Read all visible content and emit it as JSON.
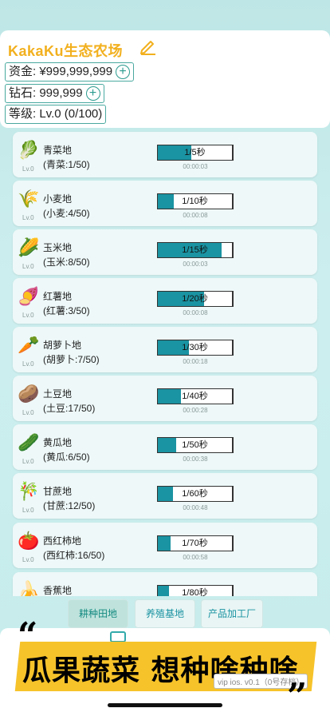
{
  "header": {
    "farm_title": "KakaKu生态农场",
    "funds": "资金: ¥999,999,999",
    "diamonds": "钻石: 999,999",
    "level": "等级: Lv.0 (0/100)",
    "plus_symbol": "+"
  },
  "crops": [
    {
      "name": "青菜地",
      "count": "(青菜:1/50)",
      "bar": "1/5秒",
      "timer": "00:00:03",
      "progress": 0.45,
      "lv": "Lv.0",
      "icon": "cabbage-icon",
      "glyph": "🥬"
    },
    {
      "name": "小麦地",
      "count": "(小麦:4/50)",
      "bar": "1/10秒",
      "timer": "00:00:08",
      "progress": 0.22,
      "lv": "Lv.0",
      "icon": "wheat-icon",
      "glyph": "🌾"
    },
    {
      "name": "玉米地",
      "count": "(玉米:8/50)",
      "bar": "1/15秒",
      "timer": "00:00:03",
      "progress": 0.86,
      "lv": "Lv.0",
      "icon": "corn-icon",
      "glyph": "🌽"
    },
    {
      "name": "红薯地",
      "count": "(红薯:3/50)",
      "bar": "1/20秒",
      "timer": "00:00:08",
      "progress": 0.62,
      "lv": "Lv.0",
      "icon": "sweet-potato-icon",
      "glyph": "🍠"
    },
    {
      "name": "胡萝卜地",
      "count": "(胡萝卜:7/50)",
      "bar": "1/30秒",
      "timer": "00:00:18",
      "progress": 0.42,
      "lv": "Lv.0",
      "icon": "carrot-icon",
      "glyph": "🥕"
    },
    {
      "name": "土豆地",
      "count": "(土豆:17/50)",
      "bar": "1/40秒",
      "timer": "00:00:28",
      "progress": 0.31,
      "lv": "Lv.0",
      "icon": "potato-icon",
      "glyph": "🥔"
    },
    {
      "name": "黄瓜地",
      "count": "(黄瓜:6/50)",
      "bar": "1/50秒",
      "timer": "00:00:38",
      "progress": 0.25,
      "lv": "Lv.0",
      "icon": "cucumber-icon",
      "glyph": "🥒"
    },
    {
      "name": "甘蔗地",
      "count": "(甘蔗:12/50)",
      "bar": "1/60秒",
      "timer": "00:00:48",
      "progress": 0.2,
      "lv": "Lv.0",
      "icon": "sugarcane-icon",
      "glyph": "🎋"
    },
    {
      "name": "西红柿地",
      "count": "(西红柿:16/50)",
      "bar": "1/70秒",
      "timer": "00:00:58",
      "progress": 0.17,
      "lv": "Lv.0",
      "icon": "tomato-icon",
      "glyph": "🍅"
    },
    {
      "name": "香蕉地",
      "count": "",
      "bar": "1/80秒",
      "timer": "",
      "progress": 0.15,
      "lv": "",
      "icon": "banana-icon",
      "glyph": "🍌"
    }
  ],
  "tabs": [
    {
      "label": "耕种田地",
      "active": true
    },
    {
      "label": "养殖基地",
      "active": false
    },
    {
      "label": "产品加工厂",
      "active": false
    }
  ],
  "promo": {
    "text": "瓜果蔬菜 想种啥种啥",
    "quote_open": "“",
    "quote_close": "”",
    "version": "vip ios. v0.1（0号存档）"
  },
  "colors": {
    "accent": "#1a93a2",
    "title": "#f2b01e",
    "promo_bg": "#f6c32a"
  }
}
